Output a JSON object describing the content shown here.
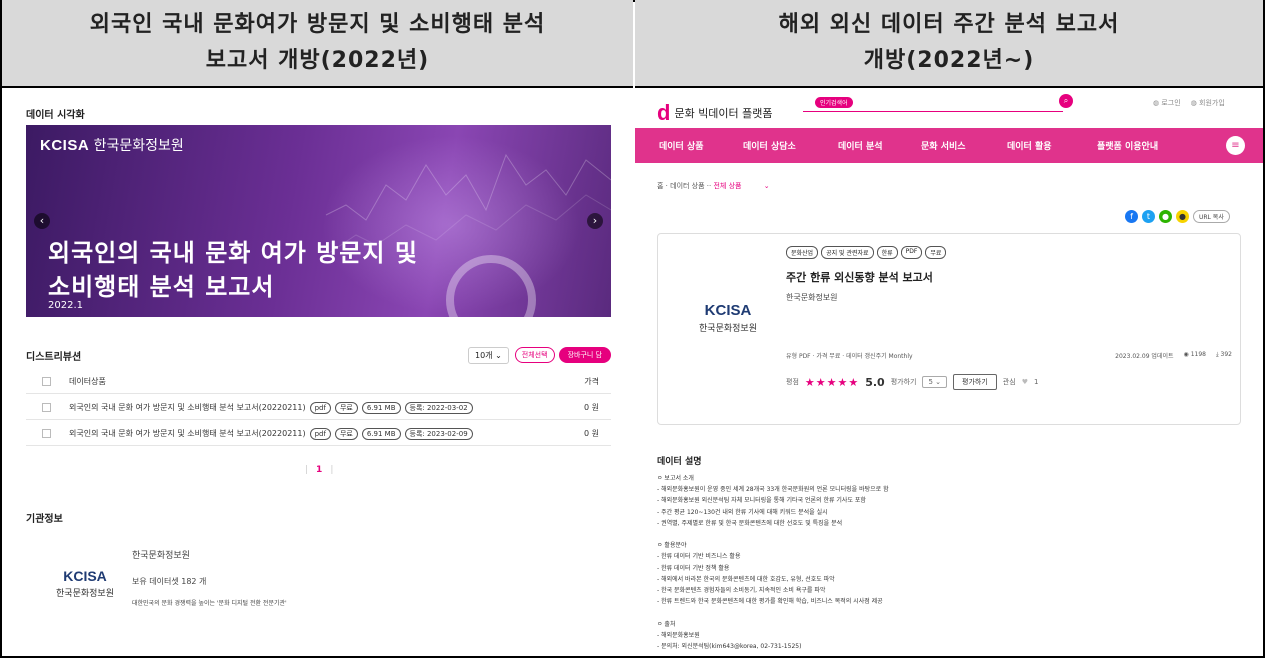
{
  "headers": {
    "left_line1": "외국인 국내 문화여가 방문지 및 소비행태 분석",
    "left_line2": "보고서 개방(2022년)",
    "right_line1": "해외 외신 데이터 주간 분석 보고서",
    "right_line2": "개방(2022년~)"
  },
  "left": {
    "section_viz": "데이터 시각화",
    "hero": {
      "logo_en": "KCISA",
      "logo_ko": "한국문화정보원",
      "title_line1": "외국인의 국내 문화 여가 방문지 및",
      "title_line2": "소비행태 분석 보고서",
      "date": "2022.1",
      "prev": "‹",
      "next": "›"
    },
    "dist": {
      "title": "디스트리뷰션",
      "page_size": "10개",
      "select_all": "전체선택",
      "cart": "장바구니 담",
      "col_product": "데이터상품",
      "col_price": "가격"
    },
    "rows": [
      {
        "name": "외국인의 국내 문화 여가 방문지 및 소비행태 분석 보고서(20220211)",
        "fmt": "pdf",
        "free": "무료",
        "size": "6.91 MB",
        "reg": "등록: 2022-03-02",
        "price": "0 원"
      },
      {
        "name": "외국인의 국내 문화 여가 방문지 및 소비행태 분석 보고서(20220211)",
        "fmt": "pdf",
        "free": "무료",
        "size": "6.91 MB",
        "reg": "등록: 2023-02-09",
        "price": "0 원"
      }
    ],
    "pager": "1",
    "org": {
      "section": "기관정보",
      "logo_en": "KCISA",
      "logo_ko": "한국문화정보원",
      "name": "한국문화정보원",
      "datasets": "보유 데이터셋 182 개",
      "slogan": "대한민국의 문화 경쟁력을 높이는 '문화 디지털 전환 전문기관'"
    }
  },
  "right": {
    "site_name": "문화 빅데이터 플랫폼",
    "search_tag": "인기검색어",
    "top_links": [
      "로그인",
      "회원가입"
    ],
    "nav": [
      "데이터 상품",
      "데이터 상담소",
      "데이터 분석",
      "문화 서비스",
      "데이터 활용",
      "플랫폼 이용안내"
    ],
    "breadcrumb": {
      "home": "홈",
      "cat": "데이터 상품",
      "current": "전체 상품"
    },
    "url_copy": "URL 복사",
    "card": {
      "chips": [
        "문화산업",
        "공지 및 관련자료",
        "한류",
        "PDF",
        "무료"
      ],
      "title": "주간 한류 외신동향 분석 보고서",
      "publisher": "한국문화정보원",
      "logo_en": "KCISA",
      "logo_ko": "한국문화정보원",
      "meta": "유형  PDF  ·  가격  무료  ·  데이터 갱신주기  Monthly",
      "updated": "2023.02.09 업데이트",
      "views": "1198",
      "downloads": "392",
      "rating_label": "평점",
      "stars": "★★★★★",
      "score": "5.0",
      "rate_label": "평가하기",
      "rate_value": "5",
      "rate_button": "평가하기",
      "interest_label": "관심",
      "interest_count": "1"
    },
    "desc_title": "데이터 설명",
    "desc_lines": [
      "ㅇ 보고서 소개",
      "- 해외문화홍보원이 운영 중인 세계 28개국 33개 한국문화원의 언론 모니터링을 바탕으로 함",
      "- 해외문화홍보원 외신분석팀 자체 모니터링을 통해 기타국 언론의 한류 기사도 포함",
      "- 주간 평균 120~130건 내외 한류 기사에 대해 키워드 분석을 실시",
      "- 권역별, 주제별로 한류 및 한국 문화콘텐츠에 대한 선호도 및 특징을 분석",
      "",
      "ㅇ 활용분야",
      "- 한류 데이터 기반 비즈니스 활용",
      "- 한류 데이터 기반 정책 활용",
      "- 해외에서 바라본 한국의 문화콘텐츠에 대한 호감도, 유형, 선호도 파악",
      "- 한국 문화콘텐츠 경험자들의 소비동기, 지속적인 소비 욕구를 파악",
      "- 한류 트렌드와 한국 문화콘텐츠에 대한 평가를 확인해 학습, 비즈니스 목적의 시사점 제공",
      "",
      "ㅇ 출처",
      "- 해외문화홍보원",
      "- 문의처: 외신분석팀(kim643@korea, 02-731-1525)"
    ]
  }
}
